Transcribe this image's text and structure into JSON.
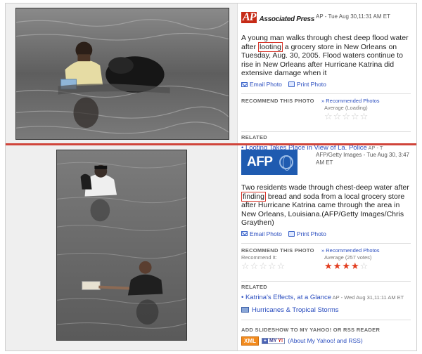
{
  "photo1": {
    "source_logo": "AP",
    "source_name": "Associated Press",
    "source_time": "AP - Tue Aug 30,11:31 AM ET",
    "caption_pre": "A young man walks through chest deep flood water after ",
    "caption_highlight": "looting",
    "caption_post": " a grocery store in New Orleans on Tuesday, Aug. 30, 2005. Flood waters continue to rise in New Orleans after Hurricane Katrina did extensive damage when it",
    "email_label": "Email Photo",
    "print_label": "Print Photo",
    "recommend_title": "RECOMMEND THIS PHOTO",
    "recommended_link": "» Recommended Photos",
    "average_label": "Average (Loading)",
    "stars_on": 0,
    "stars_total": 5,
    "related_title": "RELATED",
    "related_item": "• Looting Takes Place in View of La. Police",
    "related_meta": " AP - T",
    "colors": {
      "water": "#6b6b6b",
      "bag": "#1a1a1a"
    }
  },
  "photo2": {
    "source_logo": "AFP",
    "source_time": "AFP/Getty Images - Tue Aug 30, 3:47 AM ET",
    "caption_pre": "Two residents wade through chest-deep water after ",
    "caption_highlight": "finding",
    "caption_post": " bread and soda from a local grocery store after Hurricane Katrina came through the area in New Orleans, Louisiana.(AFP/Getty Images/Chris Graythen)",
    "email_label": "Email Photo",
    "print_label": "Print Photo",
    "recommend_title": "RECOMMEND THIS PHOTO",
    "recommended_link": "» Recommended Photos",
    "recommend_it_label": "Recommend It:",
    "average_label": "Average (257 votes)",
    "stars_on": 4,
    "stars_total": 5,
    "related_title": "RELATED",
    "related_item": "• Katrina's Effects, at a Glance",
    "related_meta": " AP - Wed Aug 31,11:11 AM ET",
    "related_item2": "Hurricanes & Tropical Storms",
    "add_title": "ADD SLIDESHOW TO MY YAHOO! OR RSS READER",
    "xml_label": "XML",
    "myyahoo_plus": "+",
    "myyahoo_my": "MY",
    "myyahoo_y": "Y!",
    "about_label": "(About My Yahoo! and RSS)"
  },
  "accent_color": "#d0443a",
  "link_color": "#2a4dbf"
}
